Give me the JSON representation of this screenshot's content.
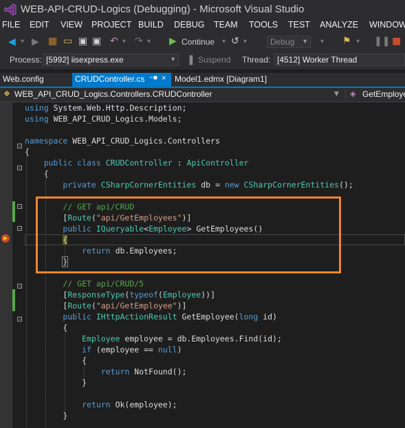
{
  "window": {
    "title": "WEB-API-CRUD-Logics (Debugging) - Microsoft Visual Studio"
  },
  "menu": [
    "FILE",
    "EDIT",
    "VIEW",
    "PROJECT",
    "BUILD",
    "DEBUG",
    "TEAM",
    "TOOLS",
    "TEST",
    "ANALYZE",
    "WINDOW"
  ],
  "toolbar": {
    "continue_label": "Continue",
    "config_value": "Debug",
    "process_label": "Process:",
    "process_value": "[5992] iisexpress.exe",
    "suspend_label": "Suspend",
    "thread_label": "Thread:",
    "thread_value": "[4512] Worker Thread"
  },
  "tabs": [
    {
      "label": "Web.config"
    },
    {
      "label": "CRUDController.cs"
    },
    {
      "label": "Model1.edmx [Diagram1]"
    }
  ],
  "navbar": {
    "class_path": "WEB_API_CRUD_Logics.Controllers.CRUDController",
    "member": "GetEmploye"
  },
  "code": {
    "l1": "System.Web.Http.Description;",
    "l2": "WEB_API_CRUD_Logics.Models;",
    "ns": "WEB_API_CRUD_Logics.Controllers",
    "cls": "CRUDController",
    "base": "ApiController",
    "ent": "CSharpCornerEntities",
    "dbname": " db = ",
    "c1": "// GET api/CRUD",
    "r1": "\"api/GetEmployees\"",
    "m1": " GetEmployees()",
    "ret1": " db.Employees;",
    "c2": "// GET api/CRUD/5",
    "r2": "\"api/GetEmployee\"",
    "m2": " GetEmployee(",
    "m2b": " id)",
    "find": " employee = db.Employees.Find(id);",
    "ifc": " (employee == ",
    "nf": " NotFound();",
    "ok": " Ok(employee);"
  },
  "colors": {
    "accent": "#007acc",
    "highlight": "#f0862c"
  }
}
